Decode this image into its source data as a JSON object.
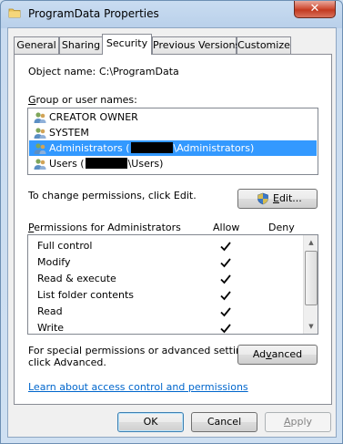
{
  "window": {
    "title": "ProgramData Properties",
    "close_label": "✕"
  },
  "tabs": [
    {
      "label": "General",
      "active": false
    },
    {
      "label": "Sharing",
      "active": false
    },
    {
      "label": "Security",
      "active": true
    },
    {
      "label": "Previous Versions",
      "active": false
    },
    {
      "label": "Customize",
      "active": false
    }
  ],
  "security": {
    "object_name_label": "Object name:",
    "object_name_value": "C:\\ProgramData",
    "group_label_accel": "G",
    "group_label_rest": "roup or user names:",
    "users": [
      {
        "name": "CREATOR OWNER",
        "selected": false
      },
      {
        "name": "SYSTEM",
        "selected": false
      },
      {
        "name_prefix": "Administrators (",
        "name_suffix": "\\Administrators)",
        "selected": true
      },
      {
        "name_prefix": "Users (",
        "name_suffix": "\\Users)",
        "selected": false
      }
    ],
    "change_permissions_text": "To change permissions, click Edit.",
    "edit_button_accel": "E",
    "edit_button_rest": "dit...",
    "permissions_label_accel": "P",
    "permissions_label_rest": "ermissions for Administrators",
    "allow_header": "Allow",
    "deny_header": "Deny",
    "permissions": [
      {
        "name": "Full control",
        "allow": true,
        "deny": false
      },
      {
        "name": "Modify",
        "allow": true,
        "deny": false
      },
      {
        "name": "Read & execute",
        "allow": true,
        "deny": false
      },
      {
        "name": "List folder contents",
        "allow": true,
        "deny": false
      },
      {
        "name": "Read",
        "allow": true,
        "deny": false
      },
      {
        "name": "Write",
        "allow": true,
        "deny": false
      }
    ],
    "special_text_line1": "For special permissions or advanced settings,",
    "special_text_line2": "click Advanced.",
    "advanced_button_pre": "Ad",
    "advanced_button_accel": "v",
    "advanced_button_post": "anced",
    "help_link": "Learn about access control and permissions"
  },
  "footer": {
    "ok_label": "OK",
    "cancel_label": "Cancel",
    "apply_accel": "A",
    "apply_rest": "pply"
  },
  "colors": {
    "selection": "#3399ff",
    "link": "#0066cc",
    "title_bar": "#b9d0ea"
  }
}
